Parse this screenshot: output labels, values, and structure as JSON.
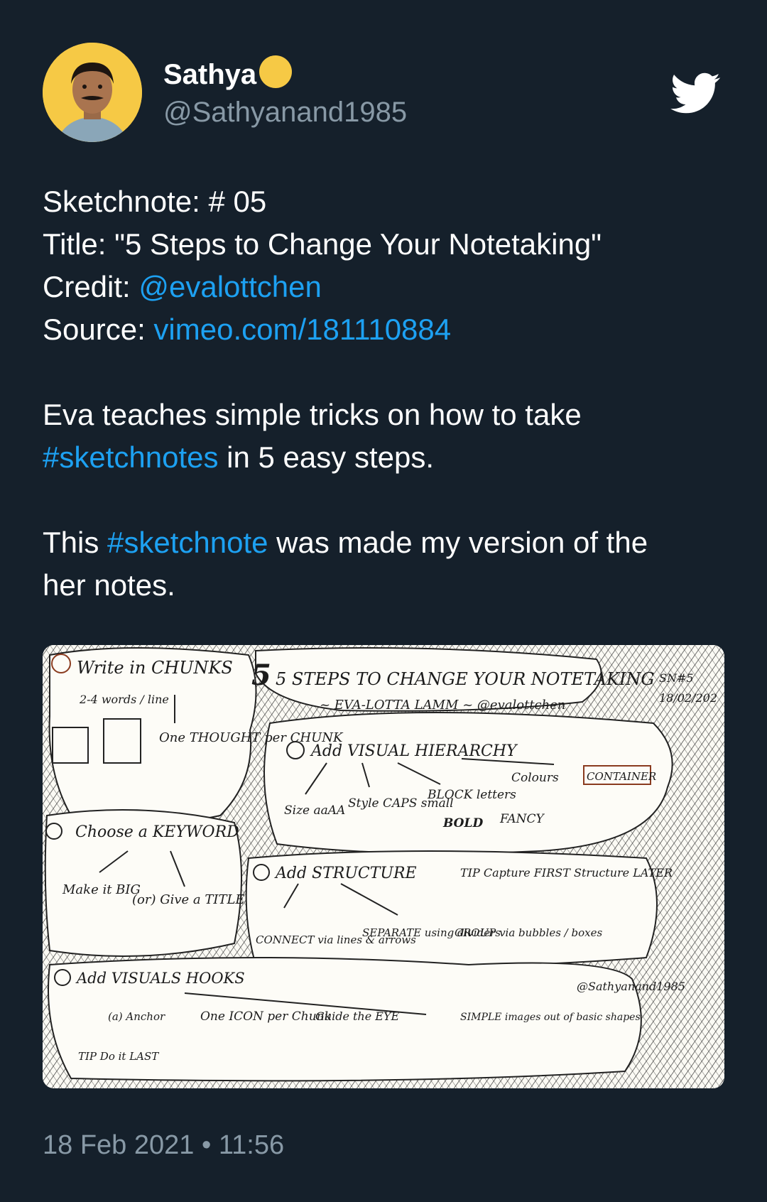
{
  "author": {
    "display_name": "Sathya",
    "handle": "@Sathyanand1985"
  },
  "tweet": {
    "lines": [
      {
        "text": "Sketchnote: # 05"
      },
      {
        "text": "Title: \"5 Steps to Change Your Notetaking\""
      },
      {
        "prefix": "Credit: ",
        "link": "@evalottchen"
      },
      {
        "prefix": "Source: ",
        "link": "vimeo.com/181110884"
      },
      {
        "text": "Eva teaches simple tricks on how to take"
      },
      {
        "link": "#sketchnotes",
        "suffix": " in 5 easy steps."
      },
      {
        "prefix": "This ",
        "link": "#sketchnote",
        "suffix": " was made my version of the"
      },
      {
        "text": "her notes."
      }
    ]
  },
  "sketchnote": {
    "title": "5 STEPS TO CHANGE YOUR NOTETAKING",
    "byline": "~ EVA-LOTTA LAMM ~ @evalottchen",
    "badge": "SN#5",
    "date": "18/02/202",
    "step1": "Write in CHUNKS",
    "step1_note": "2-4 words / line",
    "step1_sub": "One THOUGHT per CHUNK",
    "step2": "Choose a KEYWORD",
    "step2_a": "Make it BIG",
    "step2_b": "(or) Give a TITLE",
    "step3": "Add VISUAL HIERARCHY",
    "step3_items": [
      "Size aaAA",
      "Style CAPS small",
      "BLOCK letters",
      "BOLD",
      "FANCY",
      "Colours",
      "CONTAINER"
    ],
    "step4": "Add STRUCTURE",
    "step4_tip": "TIP Capture FIRST Structure LATER",
    "step4_items": [
      "CONNECT via lines & arrows",
      "SEPARATE using dividers",
      "GROUP via bubbles / boxes"
    ],
    "step5": "Add VISUALS HOOKS",
    "step5_items": [
      "(a) Anchor",
      "One ICON per Chunk",
      "Guide the EYE",
      "SIMPLE images out of basic shapes",
      "TIP Do it LAST"
    ],
    "signature": "@Sathyanand1985"
  },
  "timestamp": "18 Feb 2021 • 11:56",
  "colors": {
    "background": "#15202b",
    "link": "#1da1f2",
    "muted": "#8899a6",
    "avatar_bg": "#f6c945"
  }
}
